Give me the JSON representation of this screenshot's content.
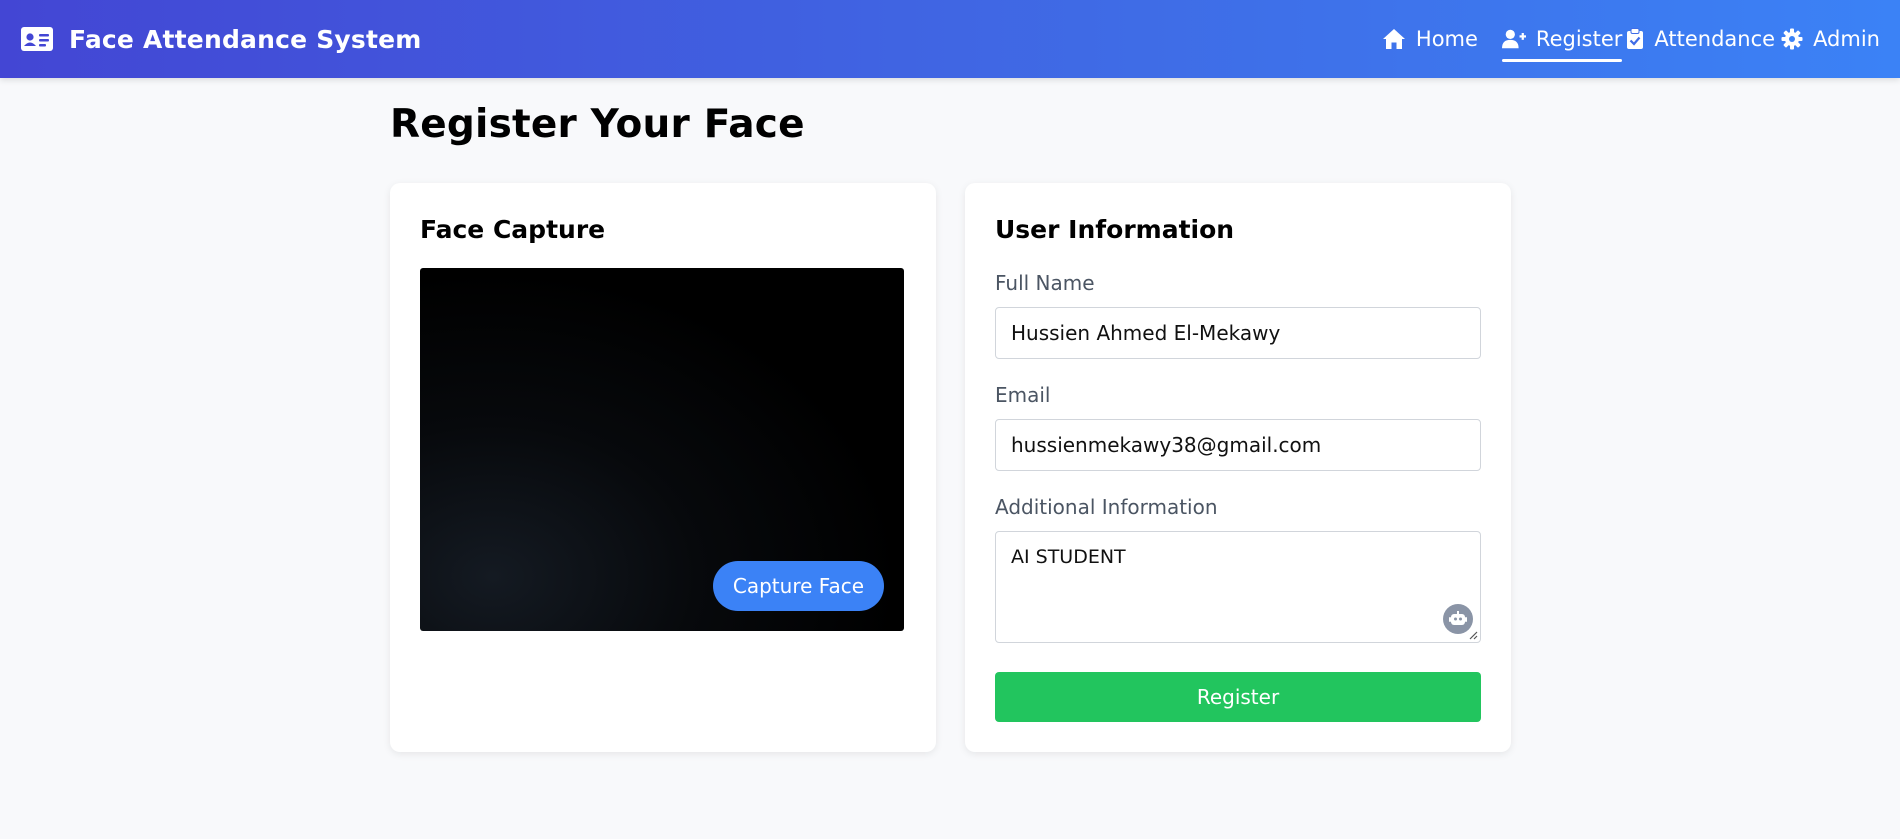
{
  "app": {
    "title": "Face Attendance System",
    "brand_icon": "id-card-icon"
  },
  "nav": {
    "items": [
      {
        "label": "Home",
        "icon": "home-icon",
        "active": false
      },
      {
        "label": "Register",
        "icon": "user-plus-icon",
        "active": true
      },
      {
        "label": "Attendance",
        "icon": "clipboard-check-icon",
        "active": false
      },
      {
        "label": "Admin",
        "icon": "gear-icon",
        "active": false
      }
    ]
  },
  "page": {
    "title": "Register Your Face"
  },
  "capture_card": {
    "title": "Face Capture",
    "capture_button": "Capture Face"
  },
  "info_card": {
    "title": "User Information",
    "full_name": {
      "label": "Full Name",
      "value": "Hussien Ahmed El-Mekawy"
    },
    "email": {
      "label": "Email",
      "value": "hussienmekawy38@gmail.com"
    },
    "additional": {
      "label": "Additional Information",
      "value": "AI STUDENT"
    },
    "register_button": "Register"
  },
  "colors": {
    "nav_gradient_start": "#4346d4",
    "nav_gradient_end": "#3b82f6",
    "capture_button": "#3b82f6",
    "register_button": "#22c55e",
    "page_background": "#f8f9fb"
  }
}
